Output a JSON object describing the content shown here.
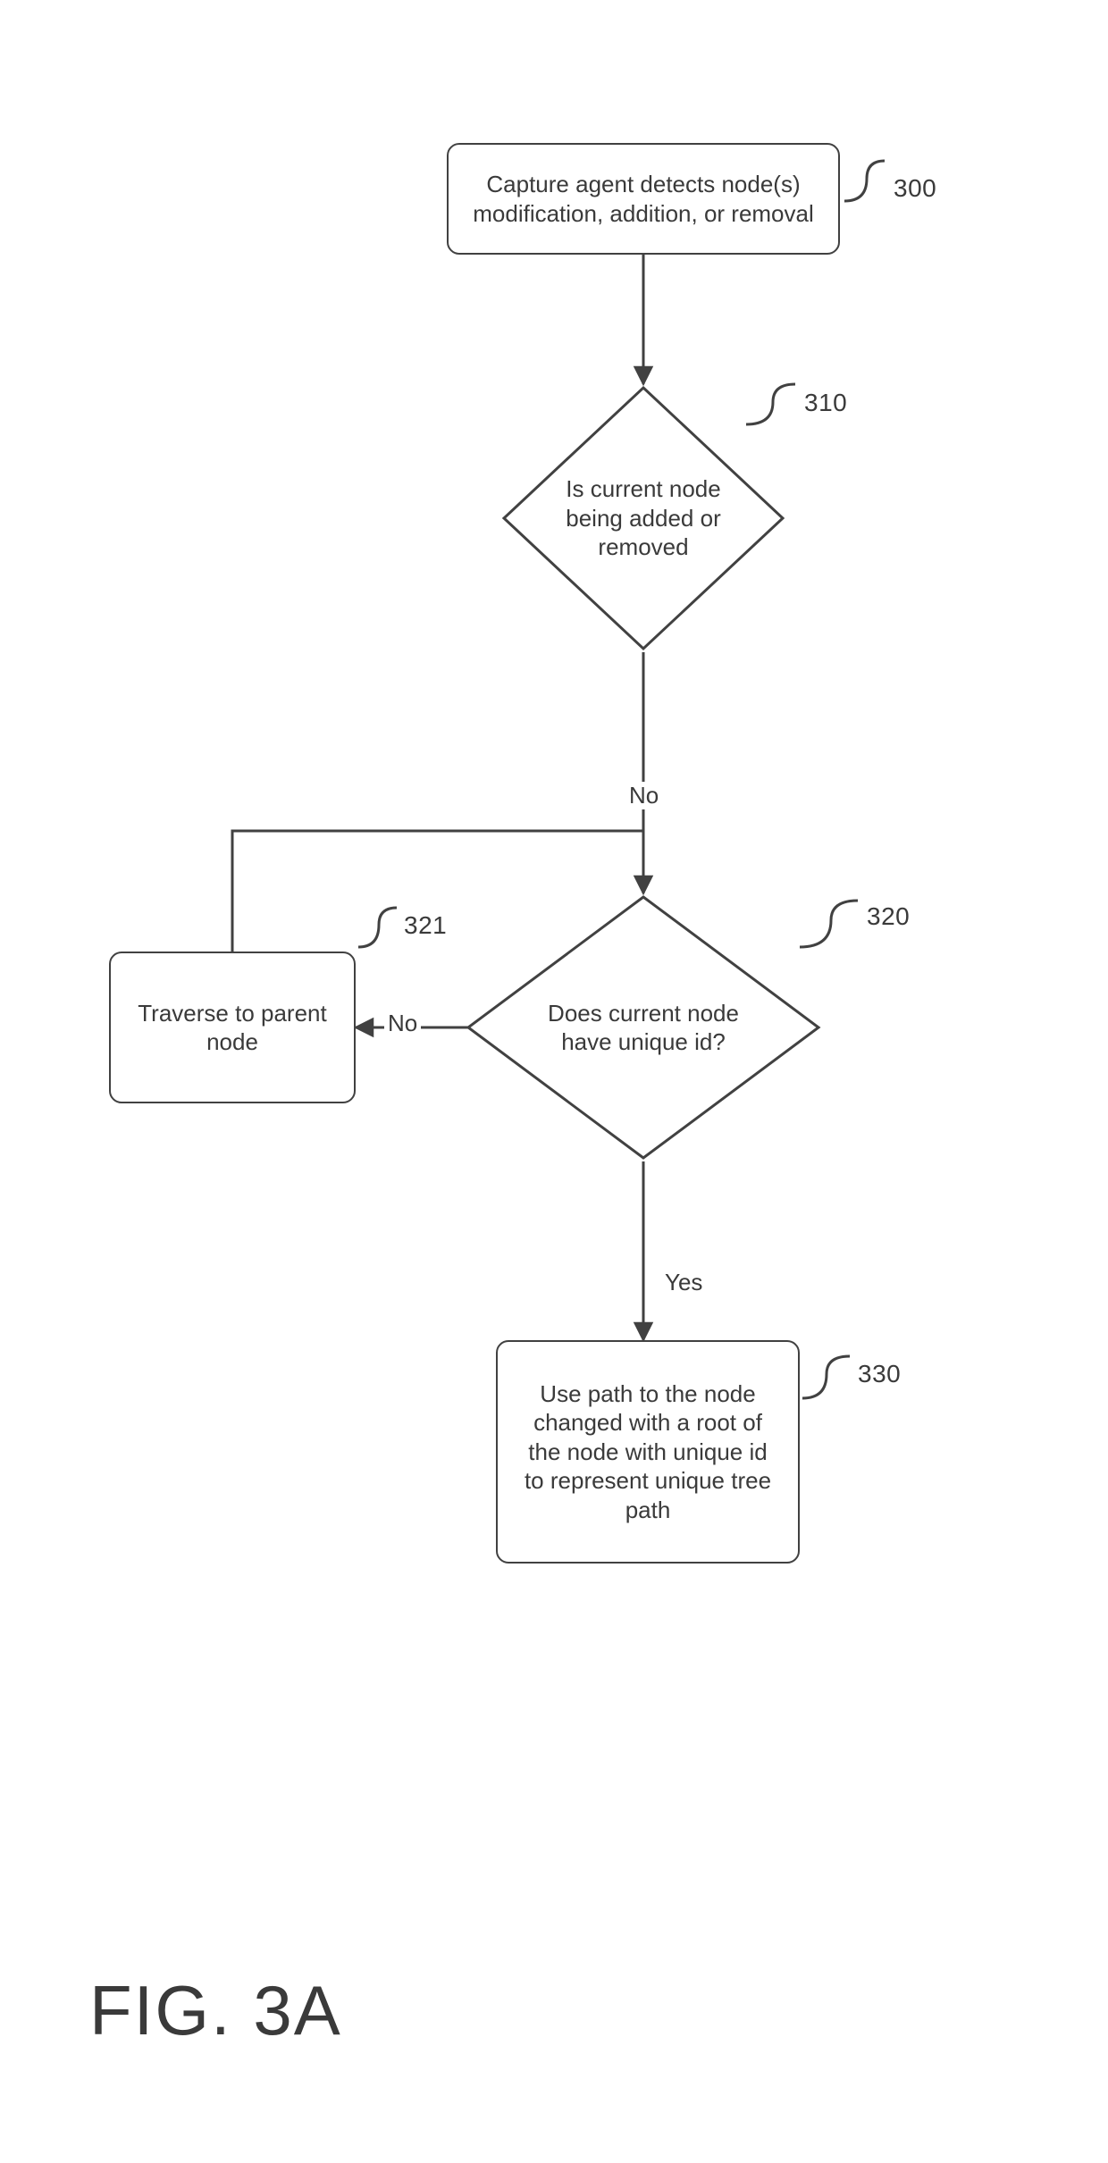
{
  "figure_label": "FIG. 3A",
  "nodes": {
    "n300": {
      "text": "Capture agent detects node(s) modification, addition, or removal",
      "ref": "300"
    },
    "n310": {
      "text": "Is current node being added or removed",
      "ref": "310"
    },
    "n320": {
      "text": "Does current node have unique id?",
      "ref": "320"
    },
    "n321": {
      "text": "Traverse to parent node",
      "ref": "321"
    },
    "n330": {
      "text": "Use path to the node changed with a root of the node with unique id to represent unique tree path",
      "ref": "330"
    }
  },
  "edges": {
    "e310_no": "No",
    "e320_no": "No",
    "e320_yes": "Yes"
  }
}
